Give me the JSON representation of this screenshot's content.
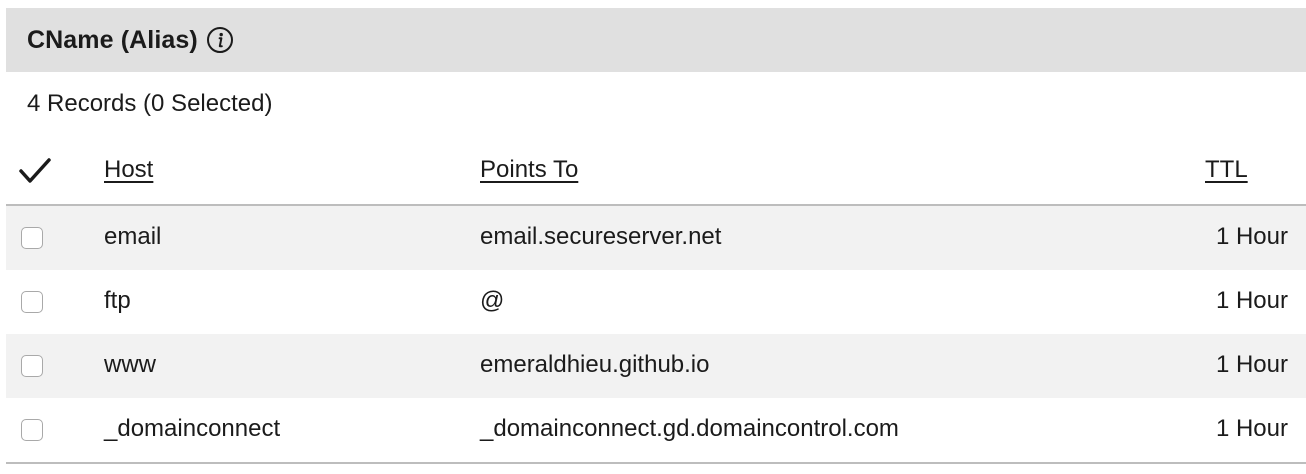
{
  "section": {
    "title": "CName (Alias)",
    "info_icon": "info-icon"
  },
  "records_summary": "4 Records (0 Selected)",
  "table": {
    "select_all_icon": "checkmark-icon",
    "columns": {
      "host": "Host",
      "points_to": "Points To",
      "ttl": "TTL"
    },
    "rows": [
      {
        "host": "email",
        "points_to": "email.secureserver.net",
        "ttl": "1 Hour",
        "selected": false
      },
      {
        "host": "ftp",
        "points_to": "@",
        "ttl": "1 Hour",
        "selected": false
      },
      {
        "host": "www",
        "points_to": "emeraldhieu.github.io",
        "ttl": "1 Hour",
        "selected": false
      },
      {
        "host": "_domainconnect",
        "points_to": "_domainconnect.gd.domaincontrol.com",
        "ttl": "1 Hour",
        "selected": false
      }
    ]
  },
  "colors": {
    "header_bg": "#e0e0e0",
    "row_shade": "#f2f2f2",
    "text": "#1b1b1b",
    "divider": "#bdbdbd"
  }
}
